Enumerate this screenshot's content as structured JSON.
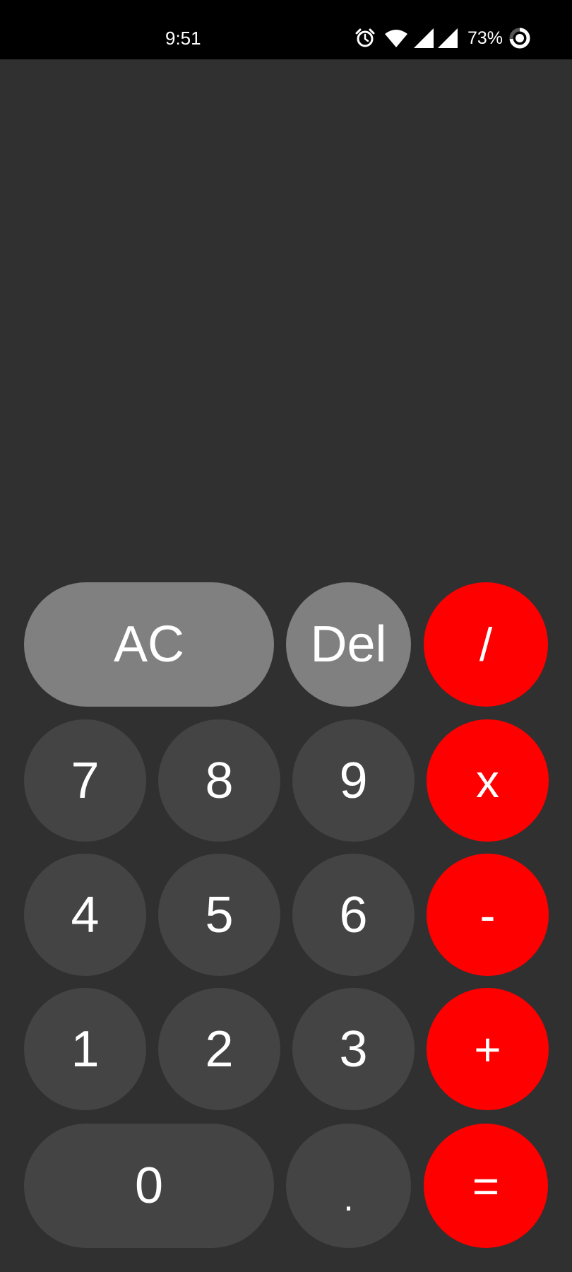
{
  "status_bar": {
    "time": "9:51",
    "battery": "73%",
    "icons": [
      "alarm-icon",
      "wifi-icon",
      "signal-icon",
      "signal-icon",
      "battery-ring-icon"
    ]
  },
  "display": {
    "value": ""
  },
  "keypad": {
    "ac": "AC",
    "del": "Del",
    "divide": "/",
    "multiply": "x",
    "subtract": "-",
    "add": "+",
    "equals": "=",
    "seven": "7",
    "eight": "8",
    "nine": "9",
    "four": "4",
    "five": "5",
    "six": "6",
    "one": "1",
    "two": "2",
    "three": "3",
    "zero": "0",
    "decimal": "."
  },
  "colors": {
    "background": "#303030",
    "status_bar": "#000000",
    "digit_key": "#444444",
    "function_key": "#808080",
    "operator_key": "#ff0000",
    "text": "#ffffff"
  }
}
